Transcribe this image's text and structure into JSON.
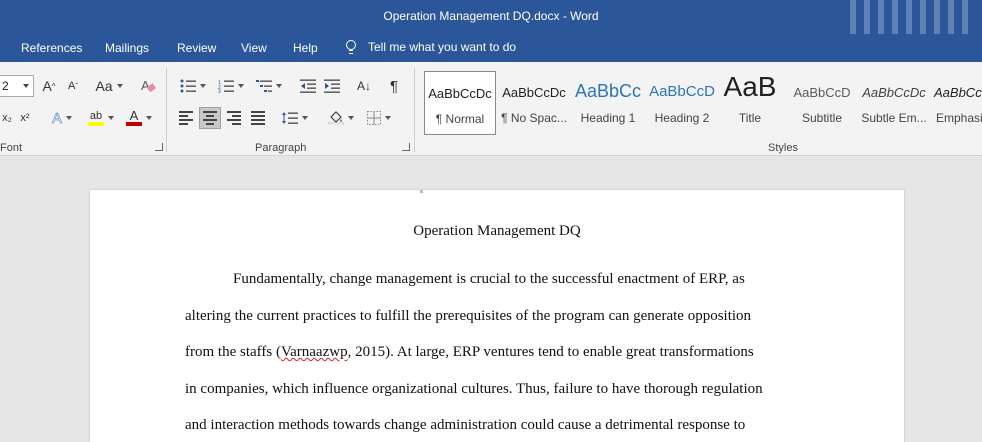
{
  "window": {
    "title": "Operation Management DQ.docx  -  Word"
  },
  "menu": {
    "tabs": [
      {
        "label": "References"
      },
      {
        "label": "Mailings"
      },
      {
        "label": "Review"
      },
      {
        "label": "View"
      },
      {
        "label": "Help"
      }
    ],
    "tell_me": "Tell me what you want to do"
  },
  "ribbon": {
    "font": {
      "size_value": "2",
      "label": "Font",
      "grow_icon_text": "A",
      "shrink_icon_text": "A",
      "change_case_text": "Aa",
      "subscript_text": "x₂",
      "superscript_text": "x²",
      "text_effects_text": "A",
      "highlight_text": "ab",
      "font_color_text": "A",
      "highlight_color": "#ffff00",
      "font_color_color": "#c00000"
    },
    "paragraph": {
      "label": "Paragraph",
      "sort_text": "A↓",
      "show_marks_text": "¶"
    },
    "styles": {
      "label": "Styles",
      "items": [
        {
          "preview": "AaBbCcDc",
          "name": "¶ Normal"
        },
        {
          "preview": "AaBbCcDc",
          "name": "¶ No Spac..."
        },
        {
          "preview": "AaBbCc",
          "name": "Heading 1"
        },
        {
          "preview": "AaBbCcD",
          "name": "Heading 2"
        },
        {
          "preview": "AaB",
          "name": "Title"
        },
        {
          "preview": "AaBbCcD",
          "name": "Subtitle"
        },
        {
          "preview": "AaBbCcDc",
          "name": "Subtle Em..."
        },
        {
          "preview": "AaBbCcDc",
          "name": "Emphasis"
        }
      ],
      "heading_color": "#2e74b5"
    }
  },
  "document": {
    "title": "Operation Management DQ",
    "lines": [
      {
        "text": "Fundamentally, change management is crucial to the successful enactment of ERP, as"
      },
      {
        "text": "altering the current practices to fulfill the prerequisites of the program can generate opposition"
      },
      {
        "before": "from the staffs (",
        "misspelled": "Varnaazwp",
        "after": ", 2015). At large, ERP ventures tend to enable great transformations"
      },
      {
        "text": "in companies, which influence organizational cultures. Thus, failure to have thorough regulation"
      },
      {
        "text": "and interaction methods towards change administration could cause a detrimental response to"
      }
    ]
  },
  "colors": {
    "accent": "#2b579a"
  }
}
